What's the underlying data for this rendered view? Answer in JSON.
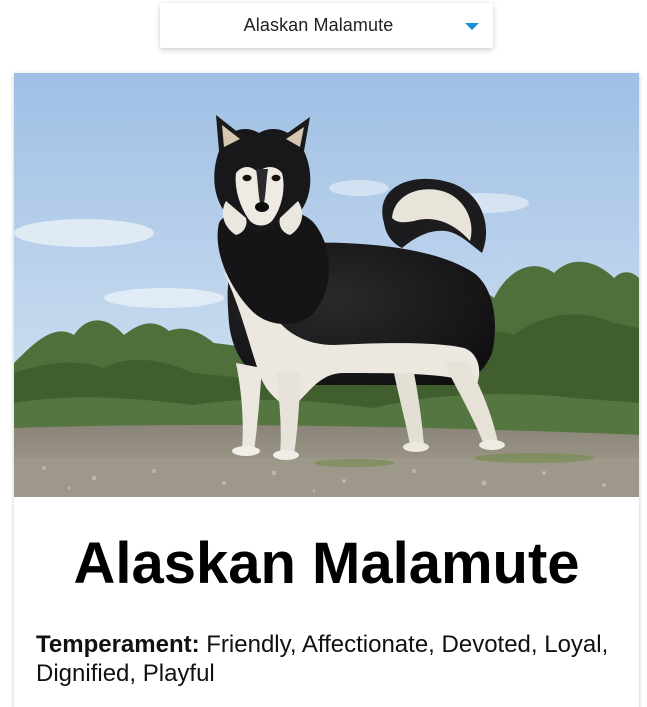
{
  "breed_select": {
    "selected_value": "Alaskan Malamute",
    "icon": "chevron-down-icon",
    "accent_color": "#1a8fd8"
  },
  "breed_card": {
    "title": "Alaskan Malamute",
    "temperament_label": "Temperament:",
    "temperament_value": "Friendly, Affectionate, Devoted, Loyal, Dignified, Playful",
    "photo_subject": "dog-photo"
  }
}
